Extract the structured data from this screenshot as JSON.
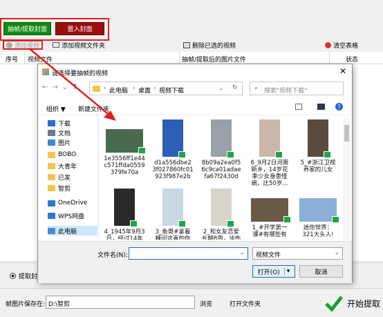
{
  "top_buttons": {
    "extract_cover": "抽帧/提取封面",
    "set_cover": "置入封面"
  },
  "toolbar": {
    "add_video": "添加视频",
    "add_folder": "添加视频文件夹",
    "delete_selected": "删除已选的视频",
    "clear_table": "清空表格"
  },
  "table": {
    "headers": [
      "序号",
      "视频文件",
      "抽帧/提取后的图片文件",
      "状态"
    ]
  },
  "bottom": {
    "mode_label": "提取封",
    "save_label": "帧图片保存在:",
    "save_path": "D:\\智剪",
    "browse": "浏览",
    "open_folder": "打开文件夹",
    "start": "开始提取"
  },
  "dialog": {
    "title": "请选择要抽帧的视频",
    "breadcrumb": [
      "此电脑",
      "桌面",
      "视频下载"
    ],
    "search_placeholder": "搜索\"视频下载\"",
    "organize": "组织 ▼",
    "new_folder": "新建文件夹",
    "nav_items": [
      {
        "label": "下载",
        "icon": "download-icon"
      },
      {
        "label": "文档",
        "icon": "document-icon"
      },
      {
        "label": "图片",
        "icon": "picture-icon"
      },
      {
        "label": "BOBO",
        "icon": "folder-icon"
      },
      {
        "label": "大青年",
        "icon": "folder-icon"
      },
      {
        "label": "已发",
        "icon": "folder-icon"
      },
      {
        "label": "智剪",
        "icon": "folder-icon"
      },
      {
        "label": "OneDrive",
        "icon": "cloud-icon"
      },
      {
        "label": "WPS网盘",
        "icon": "cloud-icon"
      },
      {
        "label": "此电脑",
        "icon": "computer-icon"
      }
    ],
    "files": [
      {
        "name": "1e3556ff1e44\nc571ffda0559\n379fe70a",
        "color": "#4a6a50"
      },
      {
        "name": "d1a556dbe2\n3f027860fc01\n923f987e2b",
        "color": "#2c5fb8"
      },
      {
        "name": "8b09a2ea0f5\n6c9ca01adae\nfa67f2430d",
        "color": "#9aa0a8"
      },
      {
        "name": "6_9月2日河南\n新乡，14岁花\n季少女身患怪\n病，比50岁...",
        "color": "#c9b8a8"
      },
      {
        "name": "5_#浙江卫视\n养家的儿女",
        "color": "#5a4a40"
      },
      {
        "name": "4_1945年9月3\n日，经过14年",
        "color": "#2a2a2a"
      },
      {
        "name": "3_鱼哥#拿着\n糖问这直的你",
        "color": "#c8d8e0"
      },
      {
        "name": "2_和女友恋爱\n长期8周，谈伤",
        "color": "#d8d4cc"
      },
      {
        "name": "1_#开学第一\n课#有哪些有",
        "color": "#6a5a48"
      },
      {
        "name": "迷你世界：\n321大头人!",
        "color": "#8ab0d8"
      }
    ],
    "filename_label": "文件名(N):",
    "filename_value": "",
    "filetype": "视频文件",
    "open": "打开(O)",
    "cancel": "取消"
  },
  "colors": {
    "green_button": "#128a12",
    "red_button": "#9b0e0e",
    "highlight_border": "#e02020",
    "arrow": "#e02020"
  }
}
